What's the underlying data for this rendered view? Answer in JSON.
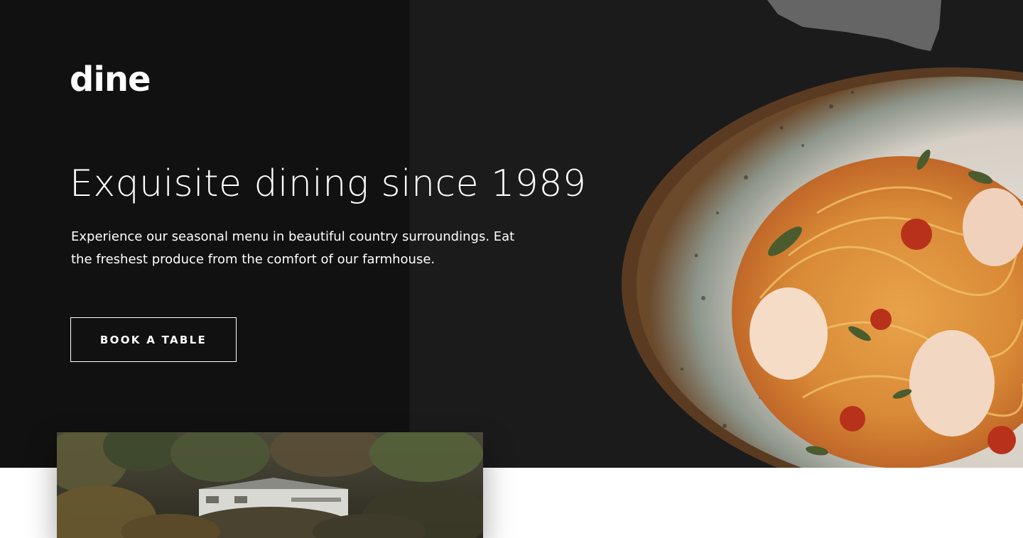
{
  "brand": {
    "logo_text": "dine"
  },
  "hero": {
    "title": "Exquisite dining since 1989",
    "description": "Experience our seasonal menu in beautiful country surroundings. Eat the freshest produce from the comfort of our farmhouse.",
    "cta_label": "BOOK A TABLE"
  },
  "images": {
    "hero_image": "pasta-plate-image",
    "feature_image": "farmhouse-in-forest-image"
  },
  "colors": {
    "hero_background": "#1b1b1b",
    "hero_left_panel": "#111111",
    "text": "#ffffff",
    "page_background": "#ffffff"
  }
}
